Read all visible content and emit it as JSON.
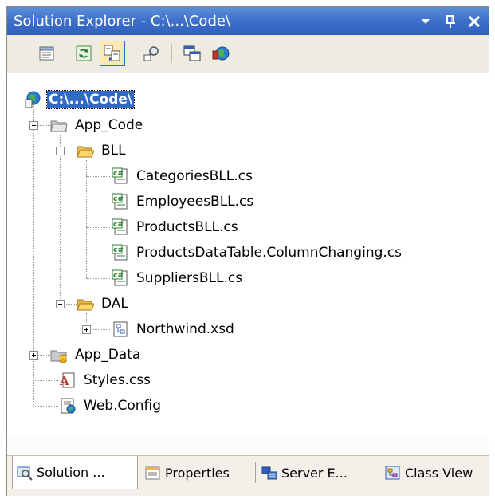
{
  "window": {
    "title": "Solution Explorer - C:\\...\\Code\\",
    "buttons": {
      "dropdown": "▼",
      "pin": "Ⅱ",
      "close": "✕"
    }
  },
  "toolbar": {
    "buttons": [
      {
        "name": "properties-button",
        "icon": "properties-icon"
      },
      {
        "name": "refresh-button",
        "icon": "refresh-icon"
      },
      {
        "name": "nest-related-files-button",
        "icon": "nest-related-files-icon",
        "active": true
      },
      {
        "name": "view-class-diagram-button",
        "icon": "view-class-diagram-icon"
      },
      {
        "name": "copy-web-site-button",
        "icon": "copy-web-site-icon"
      },
      {
        "name": "asp-net-configuration-button",
        "icon": "asp-net-configuration-icon"
      }
    ]
  },
  "tree": {
    "root": "C:\\...\\Code\\",
    "app_code": "App_Code",
    "bll": "BLL",
    "bll_files": [
      "CategoriesBLL.cs",
      "EmployeesBLL.cs",
      "ProductsBLL.cs",
      "ProductsDataTable.ColumnChanging.cs",
      "SuppliersBLL.cs"
    ],
    "dal": "DAL",
    "dal_files": [
      "Northwind.xsd"
    ],
    "app_data": "App_Data",
    "styles": "Styles.css",
    "web_config": "Web.Config"
  },
  "tabs": [
    {
      "label": "Solution ...",
      "icon": "solution-explorer-icon",
      "active": true
    },
    {
      "label": "Properties",
      "icon": "properties-window-icon",
      "active": false
    },
    {
      "label": "Server E...",
      "icon": "server-explorer-icon",
      "active": false
    },
    {
      "label": "Class View",
      "icon": "class-view-icon",
      "active": false
    }
  ],
  "colors": {
    "title_gradient_top": "#5c8fd8",
    "title_gradient_bottom": "#2f60bd",
    "selection": "#316ac5",
    "toolbar_bg": "#eeebe0"
  }
}
